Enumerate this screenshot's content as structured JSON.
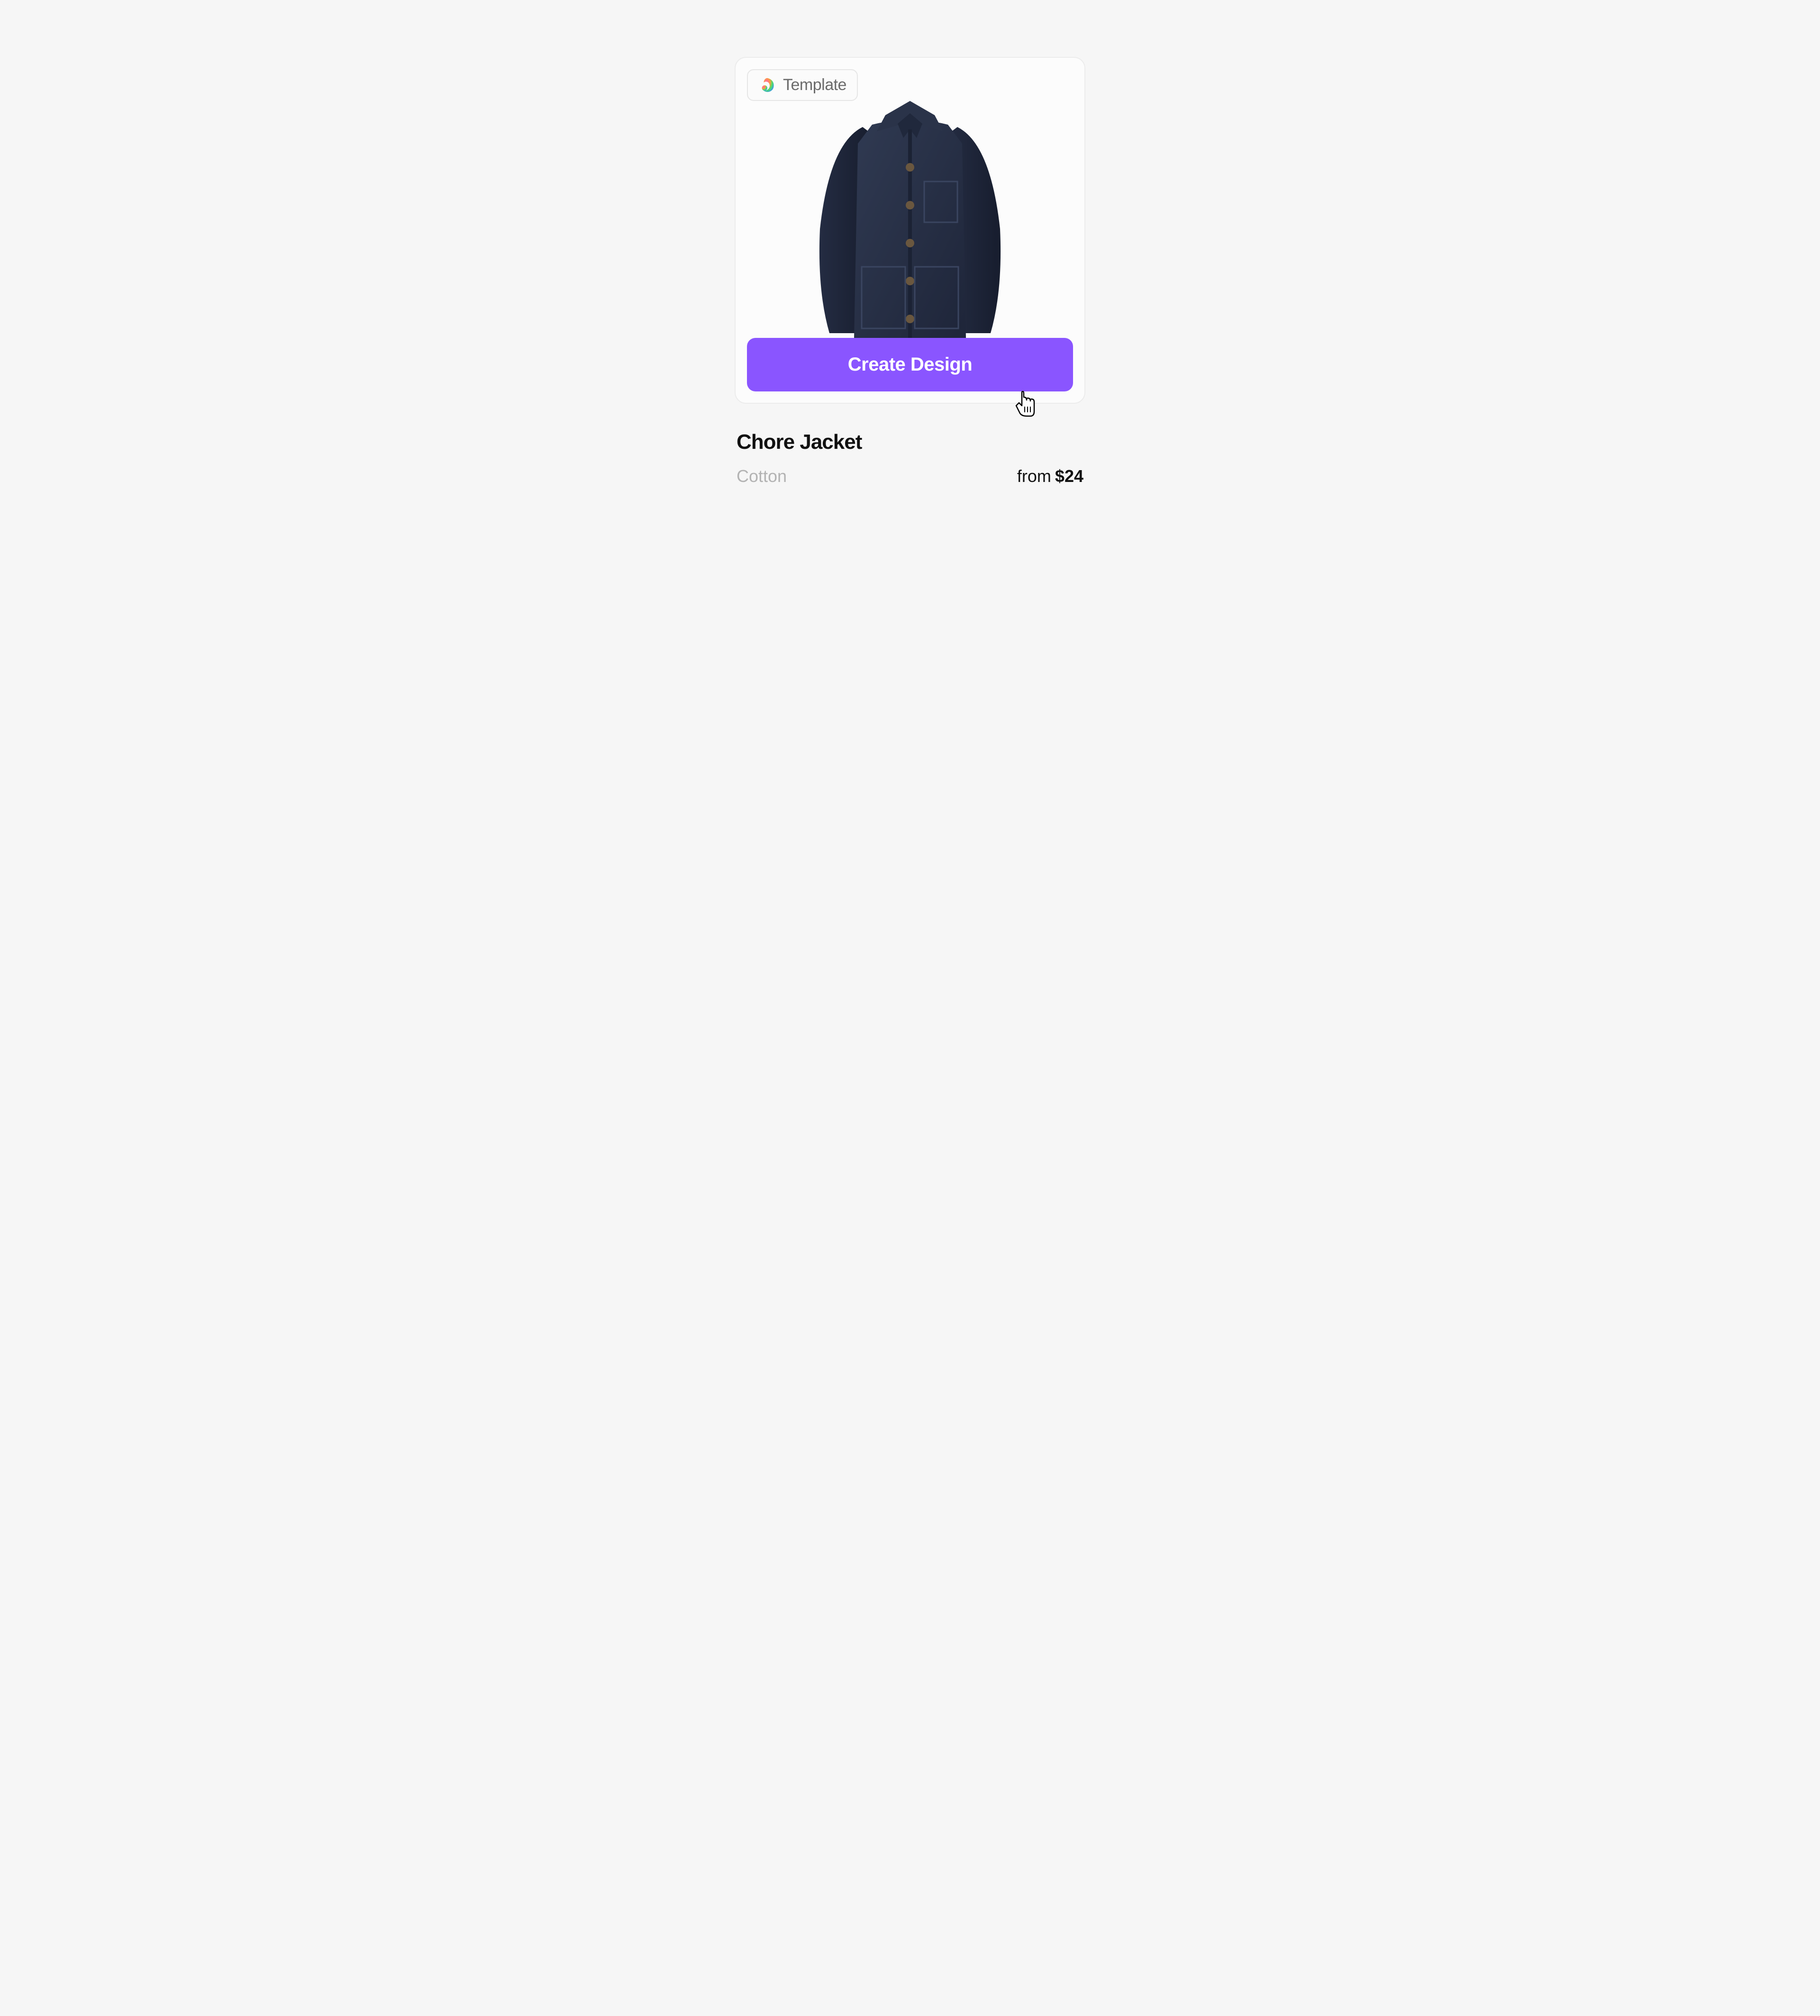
{
  "badge": {
    "label": "Template",
    "icon": "app-logo-icon"
  },
  "product": {
    "name": "Chore Jacket",
    "material": "Cotton",
    "price_prefix": "from",
    "price": "$24"
  },
  "cta": {
    "label": "Create Design"
  },
  "colors": {
    "accent": "#8a55ff"
  }
}
